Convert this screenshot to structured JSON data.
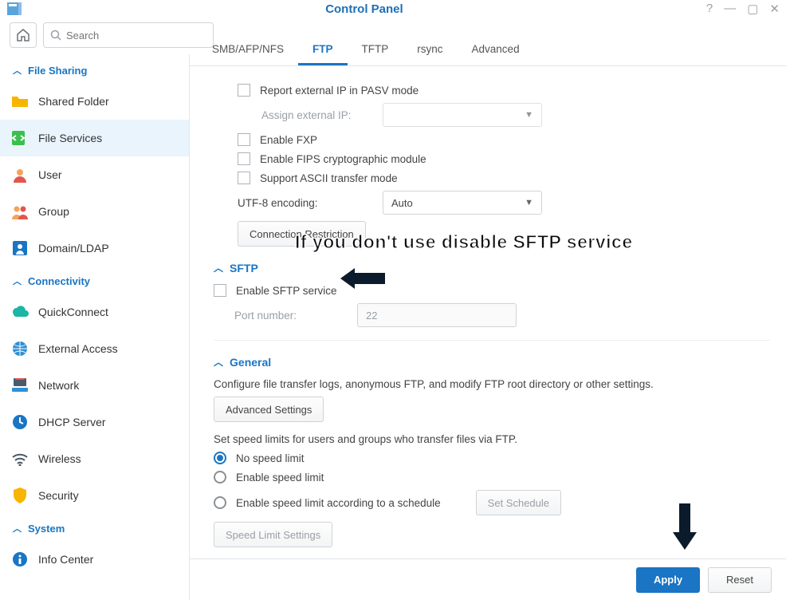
{
  "window": {
    "title": "Control Panel",
    "buttons": {
      "help": "?",
      "min": "—",
      "max": "▢",
      "close": "✕"
    }
  },
  "search": {
    "placeholder": "Search"
  },
  "sidebar": {
    "sections": [
      {
        "name": "File Sharing",
        "items": [
          {
            "id": "shared-folder",
            "label": "Shared Folder"
          },
          {
            "id": "file-services",
            "label": "File Services",
            "active": true
          },
          {
            "id": "user",
            "label": "User"
          },
          {
            "id": "group",
            "label": "Group"
          },
          {
            "id": "domain-ldap",
            "label": "Domain/LDAP"
          }
        ]
      },
      {
        "name": "Connectivity",
        "items": [
          {
            "id": "quickconnect",
            "label": "QuickConnect"
          },
          {
            "id": "external-access",
            "label": "External Access"
          },
          {
            "id": "network",
            "label": "Network"
          },
          {
            "id": "dhcp-server",
            "label": "DHCP Server"
          },
          {
            "id": "wireless",
            "label": "Wireless"
          },
          {
            "id": "security",
            "label": "Security"
          }
        ]
      },
      {
        "name": "System",
        "items": [
          {
            "id": "info-center",
            "label": "Info Center"
          }
        ]
      }
    ]
  },
  "tabs": [
    {
      "id": "smb",
      "label": "SMB/AFP/NFS"
    },
    {
      "id": "ftp",
      "label": "FTP",
      "active": true
    },
    {
      "id": "tftp",
      "label": "TFTP"
    },
    {
      "id": "rsync",
      "label": "rsync"
    },
    {
      "id": "advanced",
      "label": "Advanced"
    }
  ],
  "ftp": {
    "report_pasv": "Report external IP in PASV mode",
    "assign_ip_label": "Assign external IP:",
    "assign_ip_value": "",
    "enable_fxp": "Enable FXP",
    "enable_fips": "Enable FIPS cryptographic module",
    "ascii": "Support ASCII transfer mode",
    "utf8_label": "UTF-8 encoding:",
    "utf8_value": "Auto",
    "conn_restrict": "Connection Restriction"
  },
  "sftp": {
    "title": "SFTP",
    "enable": "Enable SFTP service",
    "port_label": "Port number:",
    "port_value": "22"
  },
  "general": {
    "title": "General",
    "desc": "Configure file transfer logs, anonymous FTP, and modify FTP root directory or other settings.",
    "adv_btn": "Advanced Settings",
    "speed_desc": "Set speed limits for users and groups who transfer files via FTP.",
    "no_limit": "No speed limit",
    "enable_limit": "Enable speed limit",
    "schedule_limit": "Enable speed limit according to a schedule",
    "set_schedule": "Set Schedule",
    "speed_settings": "Speed Limit Settings"
  },
  "footer": {
    "apply": "Apply",
    "reset": "Reset"
  },
  "annotation": {
    "text": "If you don't use disable SFTP service"
  }
}
